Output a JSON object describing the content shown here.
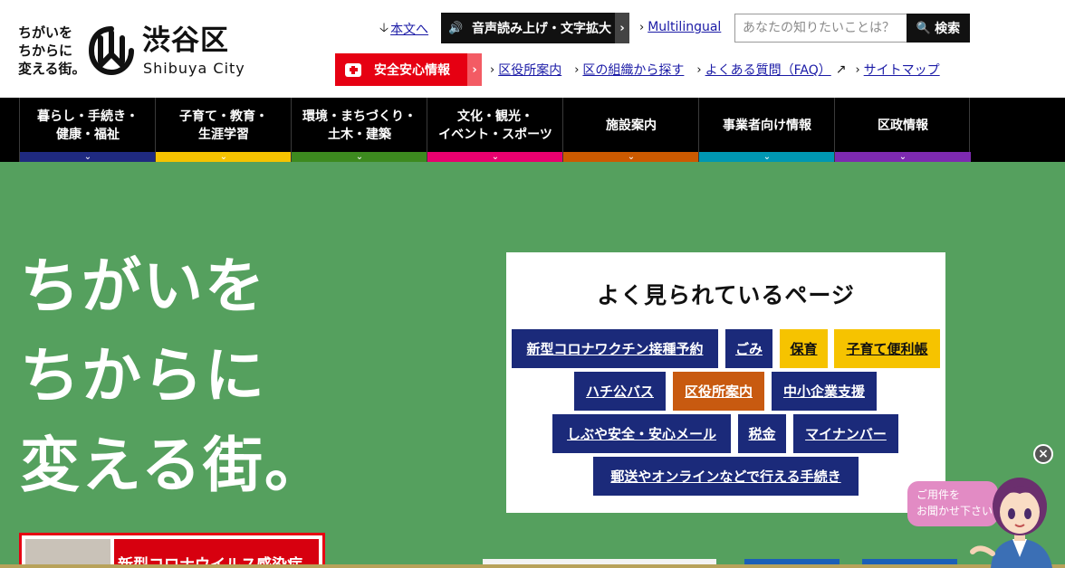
{
  "header": {
    "tagline": [
      "ちがいを",
      "ちからに",
      "変える街。"
    ],
    "logo_ja": "渋谷区",
    "logo_en": "Shibuya City",
    "skip_link": "本文へ",
    "voice_label": "音声読み上げ・文字拡大",
    "multilingual": "Multilingual",
    "search_placeholder": "あなたの知りたいことは？",
    "search_button": "検索",
    "safety_label": "安全安心情報",
    "sub_links": [
      "区役所案内",
      "区の組織から探す",
      "よくある質問（FAQ）",
      "サイトマップ"
    ]
  },
  "gnav": [
    {
      "label": "暮らし・手続き・\n健康・福祉",
      "color": "#1f2a80"
    },
    {
      "label": "子育て・教育・\n生涯学習",
      "color": "#f6c300"
    },
    {
      "label": "環境・まちづくり・\n土木・建築",
      "color": "#3d8a1f"
    },
    {
      "label": "文化・観光・\nイベント・スポーツ",
      "color": "#e8006e"
    },
    {
      "label": "施設案内",
      "color": "#cc5a00"
    },
    {
      "label": "事業者向け情報",
      "color": "#0097b2"
    },
    {
      "label": "区政情報",
      "color": "#7d2ab0"
    }
  ],
  "hero": {
    "copy": [
      "ちがいを",
      "ちからに",
      "変える街。"
    ],
    "news_text": "新型コロナウイルス感染症"
  },
  "popular": {
    "title": "よく見られているページ",
    "buttons": [
      {
        "label": "新型コロナワクチン接種予約",
        "style": "navy"
      },
      {
        "label": "ごみ",
        "style": "navy"
      },
      {
        "label": "保育",
        "style": "yellow"
      },
      {
        "label": "子育て便利帳",
        "style": "yellow"
      },
      {
        "label": "ハチ公バス",
        "style": "navy"
      },
      {
        "label": "区役所案内",
        "style": "orange"
      },
      {
        "label": "中小企業支援",
        "style": "navy"
      },
      {
        "label": "しぶや安全・安心メール",
        "style": "navy"
      },
      {
        "label": "税金",
        "style": "navy"
      },
      {
        "label": "マイナンバー",
        "style": "navy"
      },
      {
        "label": "郵送やオンラインなどで行える手続き",
        "style": "navy"
      }
    ]
  },
  "chatbot": {
    "bubble_lines": [
      "ご用件を",
      "お聞かせ下さい"
    ],
    "close_label": "×"
  },
  "colors": {
    "hero_green": "#55a05e",
    "safety_red": "#e60012",
    "link_blue": "#1a1aa6",
    "navy": "#1b2a7a"
  }
}
